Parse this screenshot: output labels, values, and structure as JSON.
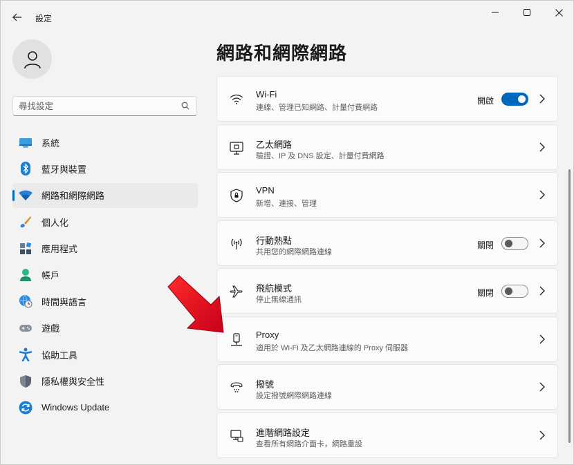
{
  "window": {
    "title": "設定",
    "controls": [
      "minimize-icon",
      "maximize-icon",
      "close-icon"
    ]
  },
  "search": {
    "placeholder": "尋找設定"
  },
  "sidebar": {
    "items": [
      {
        "label": "系統",
        "icon": "display-icon",
        "active": false
      },
      {
        "label": "藍牙與裝置",
        "icon": "bluetooth-icon",
        "active": false
      },
      {
        "label": "網路和網際網路",
        "icon": "wifi-icon",
        "active": true
      },
      {
        "label": "個人化",
        "icon": "brush-icon",
        "active": false
      },
      {
        "label": "應用程式",
        "icon": "apps-icon",
        "active": false
      },
      {
        "label": "帳戶",
        "icon": "person-icon",
        "active": false
      },
      {
        "label": "時間與語言",
        "icon": "globe-clock-icon",
        "active": false
      },
      {
        "label": "遊戲",
        "icon": "gamepad-icon",
        "active": false
      },
      {
        "label": "協助工具",
        "icon": "accessibility-icon",
        "active": false
      },
      {
        "label": "隱私權與安全性",
        "icon": "shield-icon",
        "active": false
      },
      {
        "label": "Windows Update",
        "icon": "update-icon",
        "active": false
      }
    ]
  },
  "main": {
    "title": "網路和網際網路",
    "cards": [
      {
        "title": "Wi-Fi",
        "desc": "連線、管理已知網路、計量付費網路",
        "icon": "wifi-icon",
        "status": "開啟",
        "toggle": "on"
      },
      {
        "title": "乙太網路",
        "desc": "驗證、IP 及 DNS 設定、計量付費網路",
        "icon": "ethernet-icon"
      },
      {
        "title": "VPN",
        "desc": "新增、連接、管理",
        "icon": "vpn-shield-icon"
      },
      {
        "title": "行動熱點",
        "desc": "共用您的網際網路連線",
        "icon": "hotspot-icon",
        "status": "關閉",
        "toggle": "off"
      },
      {
        "title": "飛航模式",
        "desc": "停止無線通訊",
        "icon": "airplane-icon",
        "status": "關閉",
        "toggle": "off"
      },
      {
        "title": "Proxy",
        "desc": "適用於 Wi-Fi 及乙太網路連線的 Proxy 伺服器",
        "icon": "proxy-icon"
      },
      {
        "title": "撥號",
        "desc": "設定撥號網際網路連線",
        "icon": "dialup-icon"
      },
      {
        "title": "進階網路設定",
        "desc": "查看所有網路介面卡，網路重設",
        "icon": "advanced-network-icon"
      }
    ]
  },
  "colors": {
    "accent": "#0067c0",
    "annotation_arrow": "#e8001c"
  }
}
